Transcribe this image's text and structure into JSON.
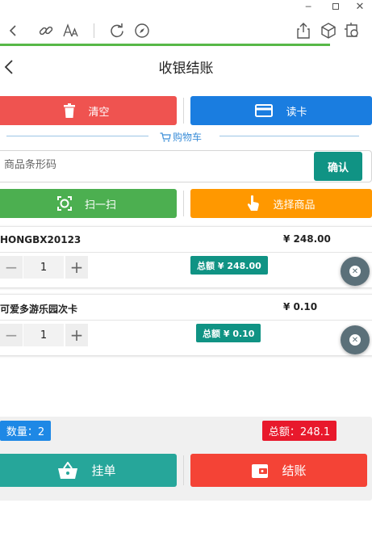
{
  "page": {
    "title": "收银结账"
  },
  "actions": {
    "clear_label": "清空",
    "card_label": "读卡",
    "scan_label": "扫一扫",
    "select_label": "选择商品"
  },
  "cart": {
    "section_label": "购物车"
  },
  "barcode": {
    "placeholder": "商品条形码",
    "confirm_label": "确认"
  },
  "items": [
    {
      "name": "HONGBX20123",
      "price": "¥ 248.00",
      "qty": "1",
      "total": "总额 ¥ 248.00"
    },
    {
      "name": "可爱多游乐园次卡",
      "price": "¥ 0.10",
      "qty": "1",
      "total": "总额 ¥ 0.10"
    }
  ],
  "summary": {
    "count": "数量：2",
    "amount": "总额：248.1"
  },
  "footer": {
    "hold_label": "挂单",
    "checkout_label": "结账"
  },
  "colors": {
    "clear": "#ef5350",
    "card": "#1a7de0",
    "scan": "#4caf50",
    "select": "#ff9800",
    "confirm": "#109384",
    "hold": "#26a69a",
    "checkout": "#f44336",
    "count_badge": "#1e88e5",
    "sum_badge": "#e8192c"
  }
}
